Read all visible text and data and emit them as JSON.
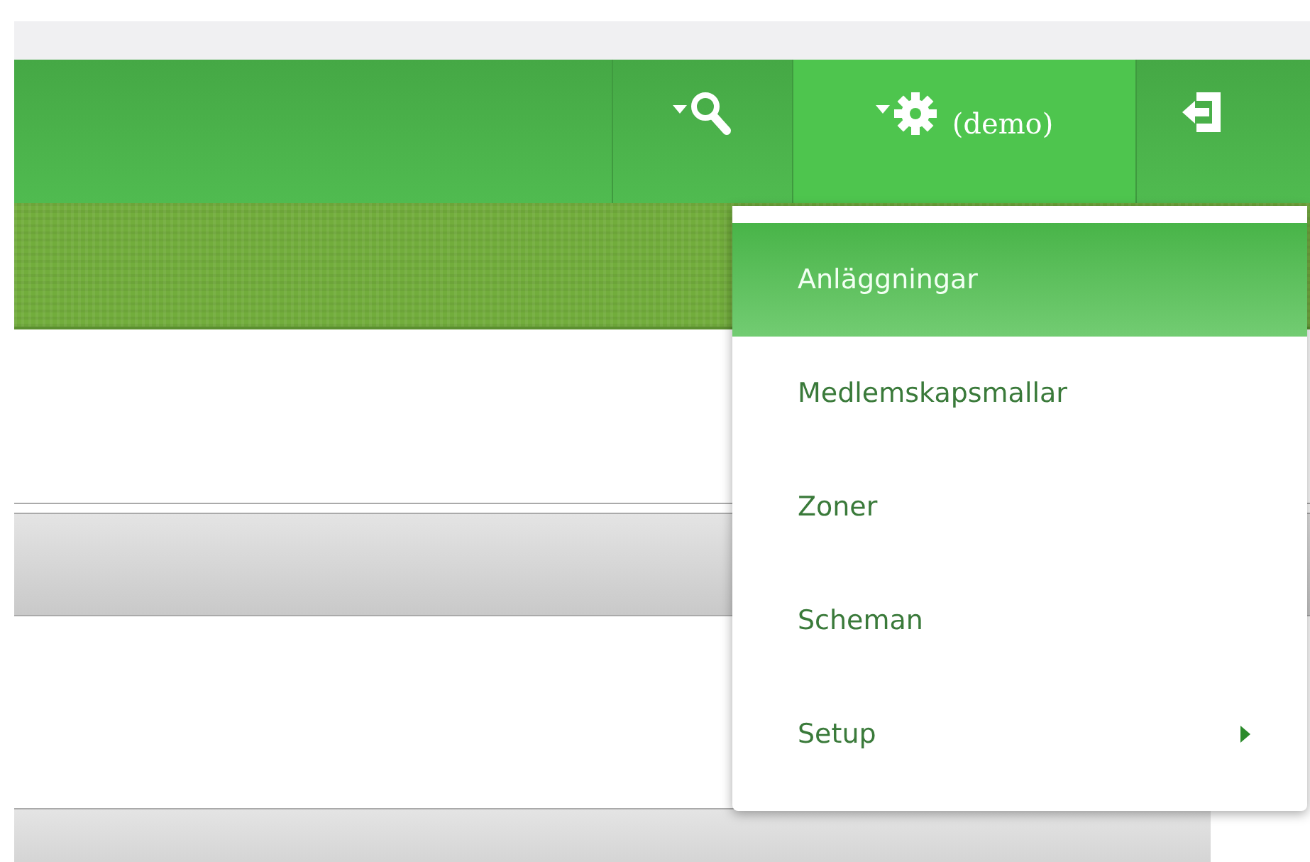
{
  "header": {
    "search_menu": {
      "expanded": false
    },
    "settings_menu": {
      "label": "(demo)",
      "expanded": true
    }
  },
  "settings_dropdown": {
    "items": [
      {
        "label": "Anläggningar",
        "selected": true,
        "has_submenu": false
      },
      {
        "label": "Medlemskapsmallar",
        "selected": false,
        "has_submenu": false
      },
      {
        "label": "Zoner",
        "selected": false,
        "has_submenu": false
      },
      {
        "label": "Scheman",
        "selected": false,
        "has_submenu": false
      },
      {
        "label": "Setup",
        "selected": false,
        "has_submenu": true
      }
    ]
  }
}
